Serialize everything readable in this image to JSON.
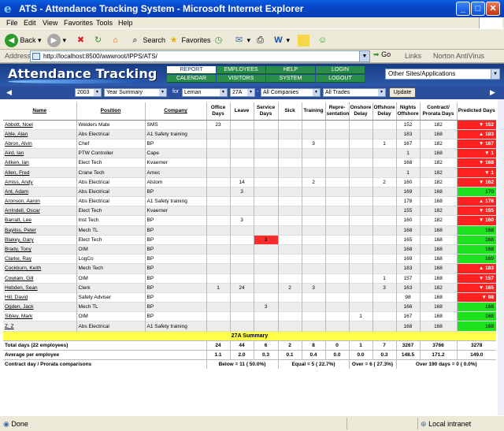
{
  "window": {
    "title": "ATS - Attendance Tracking System - Microsoft Internet Explorer"
  },
  "menu": [
    "File",
    "Edit",
    "View",
    "Favorites",
    "Tools",
    "Help"
  ],
  "toolbar": {
    "back": "Back",
    "search": "Search",
    "favorites": "Favorites"
  },
  "address": {
    "label": "Address",
    "url": "http://localhost:8500/wwwroot/IPPS/ATS/",
    "go": "Go",
    "links": "Links",
    "norton": "Norton AntiVirus"
  },
  "app": {
    "logo": "Attendance Tracking",
    "nav": [
      "REPORT",
      "EMPLOYEES",
      "HELP",
      "LOGIN",
      "CALENDAR",
      "VISITORS",
      "SYSTEM",
      "LOGOUT"
    ],
    "sites": "Other Sites/Applications",
    "filters": {
      "year": "2003",
      "report": "Year Summary",
      "for_label": "for",
      "location": "Leman",
      "group": "27A",
      "company": "All Companies",
      "trade": "All Trades",
      "update": "Update"
    }
  },
  "table": {
    "headers": [
      "Name",
      "Position",
      "Company",
      "Office Days",
      "Leave",
      "Service Days",
      "Sick",
      "Training",
      "Repre-sentation",
      "Onshore Delay",
      "Offshore Delay",
      "Nights Offshore",
      "Contract/ Prorata Days",
      "Predicted Days"
    ],
    "rows": [
      [
        "Abbott, Noel",
        "Welders Mate",
        "SMS",
        "23",
        "",
        "",
        "",
        "",
        "",
        "",
        "",
        "152",
        "182",
        "▼ 152"
      ],
      [
        "Able, Alan",
        "Abs Electrical",
        "A1 Safety training",
        "",
        "",
        "",
        "",
        "",
        "",
        "",
        "",
        "183",
        "168",
        "▲ 183"
      ],
      [
        "Abron, Alvin",
        "Chef",
        "BP",
        "",
        "",
        "",
        "",
        "3",
        "",
        "",
        "1",
        "167",
        "182",
        "▼ 167"
      ],
      [
        "Aird, Ian",
        "PTW Controller",
        "Cape",
        "",
        "",
        "",
        "",
        "",
        "",
        "",
        "",
        "1",
        "168",
        "▼ 1"
      ],
      [
        "Aitken, Ian",
        "Elect Tech",
        "Kvaerner",
        "",
        "",
        "",
        "",
        "",
        "",
        "",
        "",
        "168",
        "182",
        "▼ 168"
      ],
      [
        "Allen, Fred",
        "Crane Tech",
        "Amec",
        "",
        "",
        "",
        "",
        "",
        "",
        "",
        "",
        "1",
        "182",
        "▼ 1"
      ],
      [
        "Amiss, Andy",
        "Abs Electrical",
        "Alstom",
        "",
        "14",
        "",
        "",
        "2",
        "",
        "",
        "2",
        "160",
        "182",
        "▼ 162"
      ],
      [
        "Ant, Adam",
        "Abs Electrical",
        "BP",
        "",
        "3",
        "",
        "",
        "",
        "",
        "",
        "",
        "169",
        "168",
        "170"
      ],
      [
        "Aronson, Aaron",
        "Abs Electrical",
        "A1 Safety training",
        "",
        "",
        "",
        "",
        "",
        "",
        "",
        "",
        "178",
        "168",
        "▲ 178"
      ],
      [
        "Arrindell, Oscar",
        "Elect Tech",
        "Kvaerner",
        "",
        "",
        "",
        "",
        "",
        "",
        "",
        "",
        "155",
        "182",
        "▼ 155"
      ],
      [
        "Barratt, Lee",
        "Inst Tech",
        "BP",
        "",
        "3",
        "",
        "",
        "",
        "",
        "",
        "",
        "160",
        "182",
        "▼ 160"
      ],
      [
        "Bayliss, Peter",
        "Mech TL",
        "BP",
        "",
        "",
        "",
        "",
        "",
        "",
        "",
        "",
        "168",
        "168",
        "168"
      ],
      [
        "Blakey, Gary",
        "Elect Tech",
        "BP",
        "",
        "",
        "3",
        "",
        "",
        "",
        "",
        "",
        "165",
        "168",
        "168"
      ],
      [
        "Brady, Tony",
        "OIM",
        "BP",
        "",
        "",
        "",
        "",
        "",
        "",
        "",
        "",
        "168",
        "168",
        "168"
      ],
      [
        "Clarke, Ray",
        "LogCo",
        "BP",
        "",
        "",
        "",
        "",
        "",
        "",
        "",
        "",
        "169",
        "168",
        "169"
      ],
      [
        "Cockburn, Keith",
        "Mech Tech",
        "BP",
        "",
        "",
        "",
        "",
        "",
        "",
        "",
        "",
        "183",
        "168",
        "▲ 183"
      ],
      [
        "Cowlam, Gill",
        "OIM",
        "BP",
        "",
        "",
        "",
        "",
        "",
        "",
        "",
        "1",
        "157",
        "168",
        "▼ 157"
      ],
      [
        "Hebden, Sean",
        "Clerk",
        "BP",
        "1",
        "24",
        "",
        "2",
        "3",
        "",
        "",
        "3",
        "163",
        "182",
        "▼ 165"
      ],
      [
        "Hill, David",
        "Safety Adviser",
        "BP",
        "",
        "",
        "",
        "",
        "",
        "",
        "",
        "",
        "98",
        "168",
        "▼ 98"
      ],
      [
        "Ogden, Jack",
        "Mech TL",
        "BP",
        "",
        "",
        "3",
        "",
        "",
        "",
        "",
        "",
        "166",
        "168",
        "168"
      ],
      [
        "Sibley, Mark",
        "OIM",
        "BP",
        "",
        "",
        "",
        "",
        "",
        "",
        "1",
        "",
        "167",
        "168",
        "168"
      ],
      [
        "Z, Z",
        "Abs Electrical",
        "A1 Safety training",
        "",
        "",
        "",
        "",
        "",
        "",
        "",
        "",
        "168",
        "168",
        "168"
      ]
    ],
    "summary_title": "27A Summary",
    "totals_label": "Total days (22 employees)",
    "totals": [
      "24",
      "44",
      "6",
      "2",
      "8",
      "0",
      "1",
      "7",
      "3267",
      "3766",
      "3278"
    ],
    "avg_label": "Average per employee",
    "avg": [
      "1.1",
      "2.0",
      "0.3",
      "0.1",
      "0.4",
      "0.0",
      "0.0",
      "0.3",
      "148.5",
      "171.2",
      "149.0"
    ],
    "compare_label": "Contract day / Prorata comparisons",
    "compare_below": "Below = 11 ( 50.0%)",
    "compare_equal": "Equal = 5 ( 22.7%)",
    "compare_over": "Over = 6 ( 27.3%)",
    "compare_over190": "Over 190 days = 0 ( 0.0%)"
  },
  "status": {
    "left": "Done",
    "zone": "Local intranet"
  },
  "colors": {
    "red": "#ff2020",
    "green": "#1ee21e",
    "summary": "#ffff4a"
  }
}
